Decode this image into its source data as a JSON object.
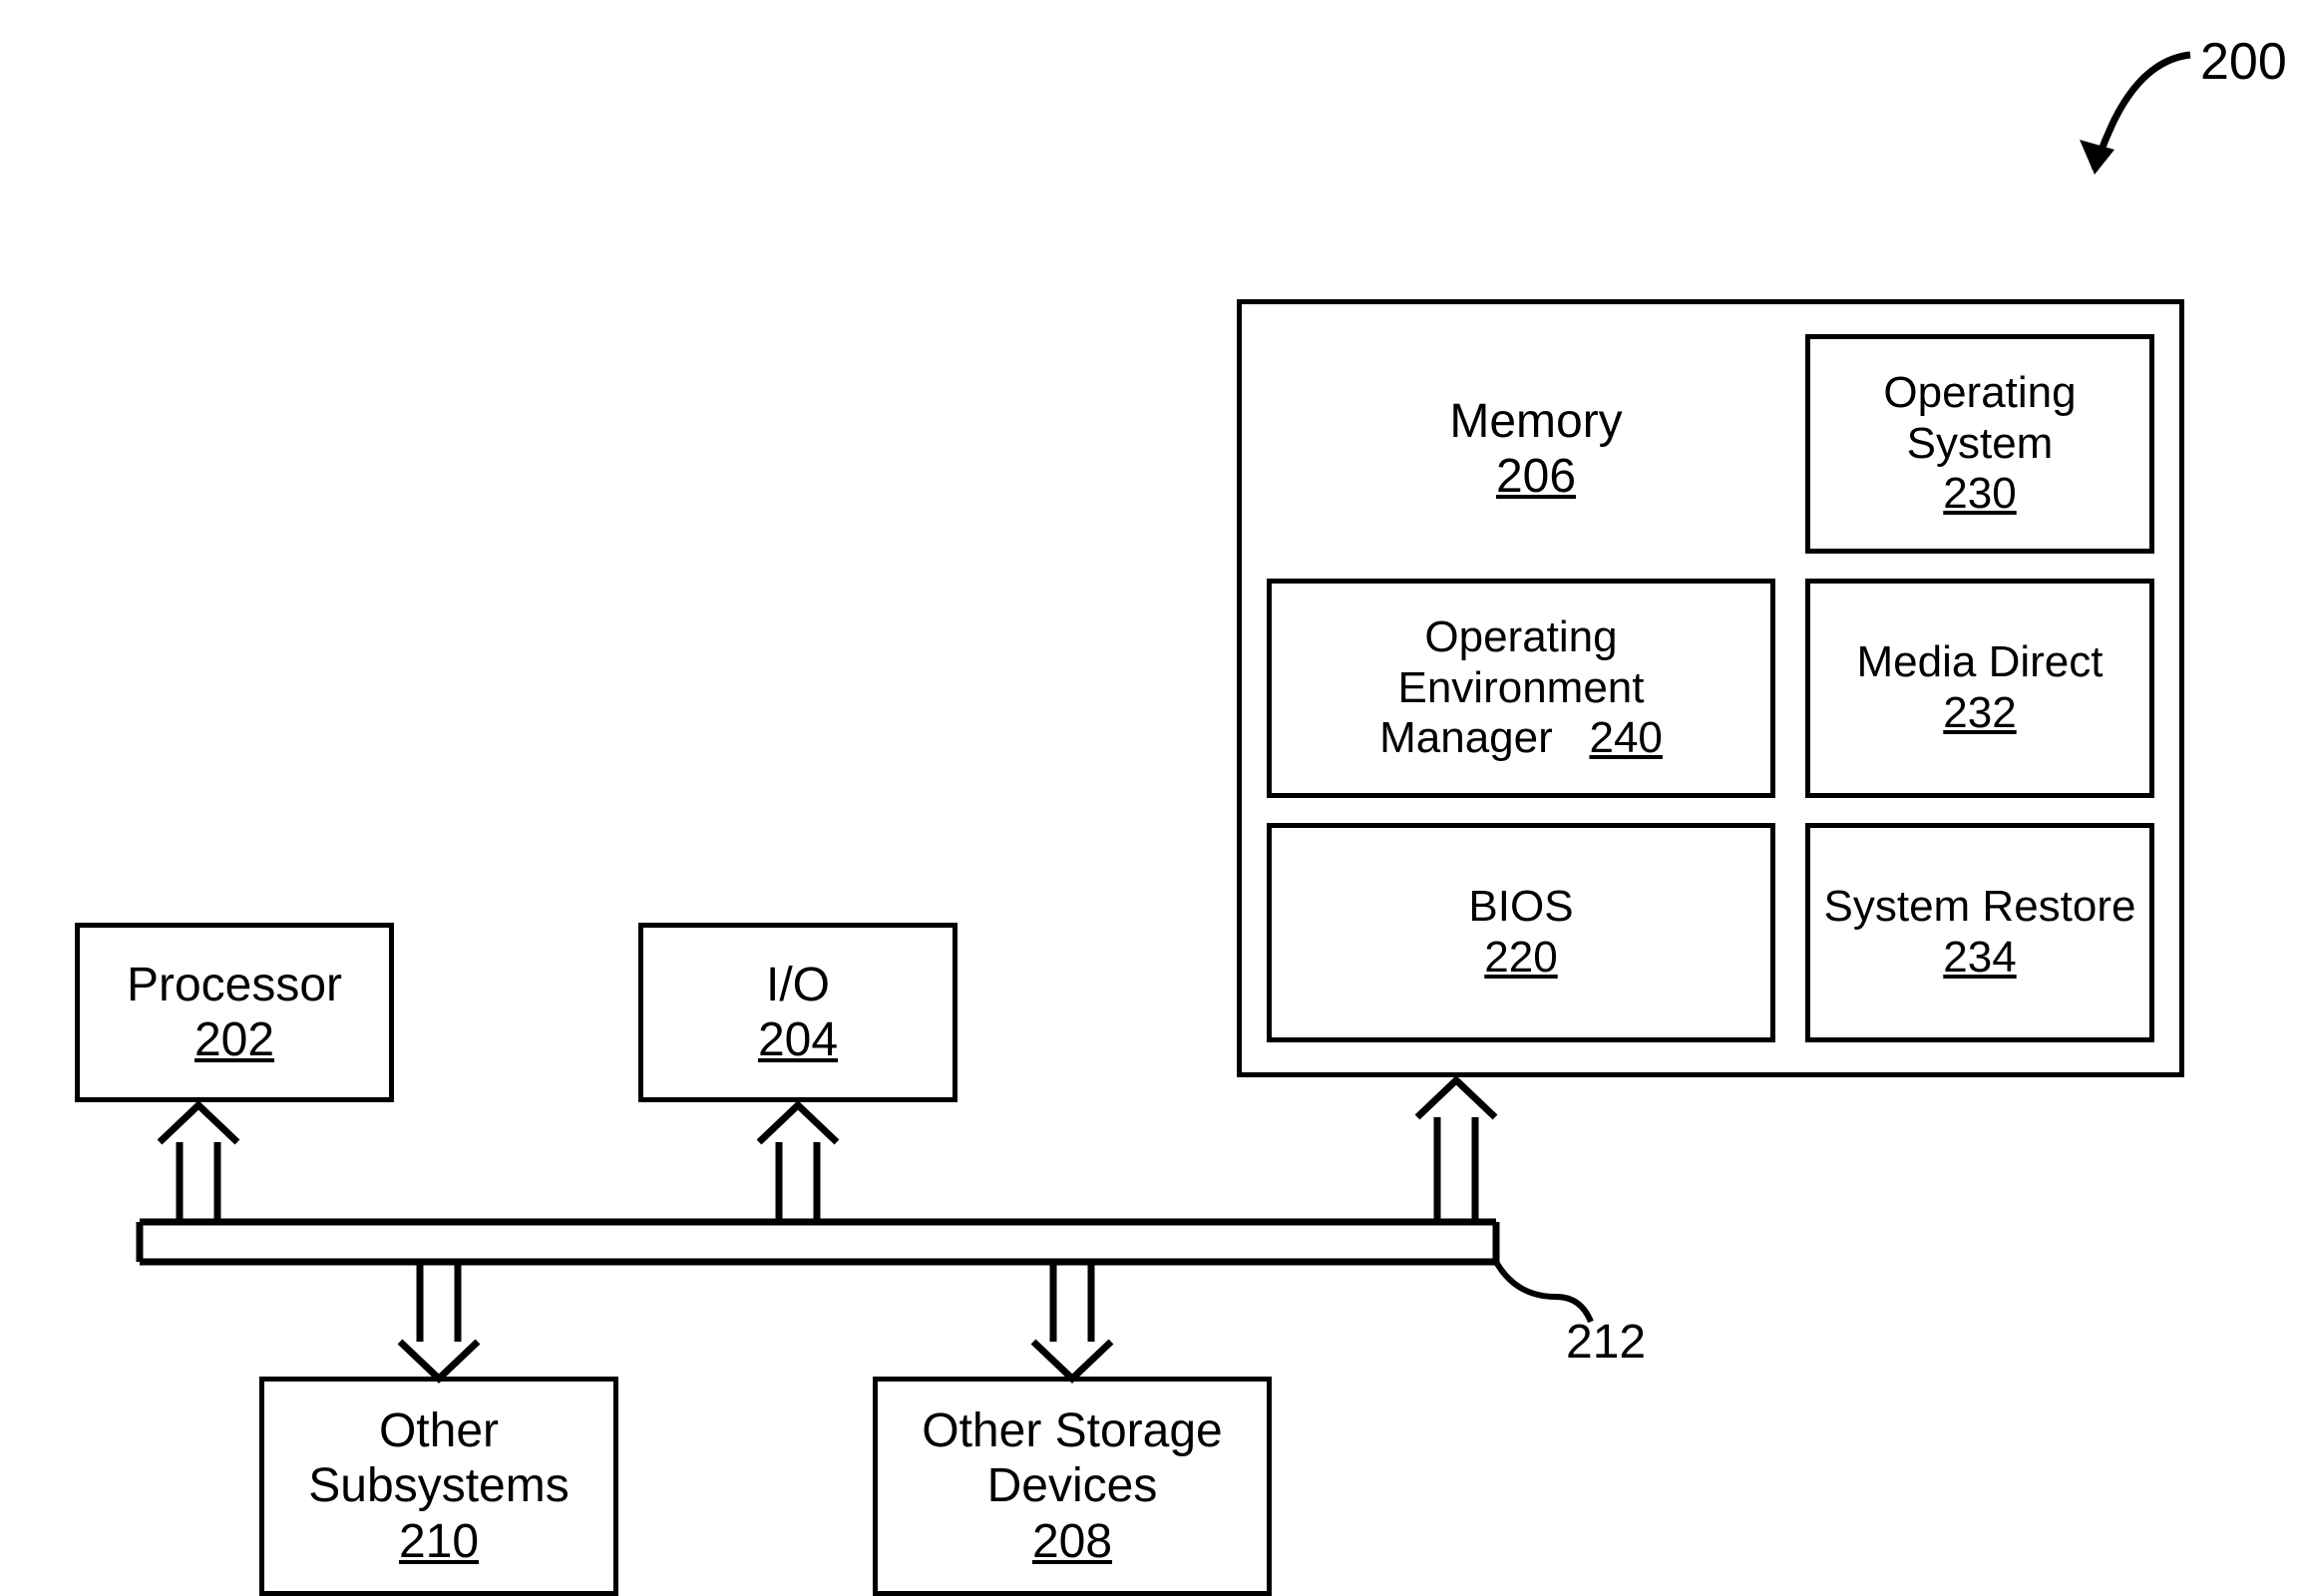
{
  "figure_ref": "200",
  "bus_ref": "212",
  "boxes": {
    "processor": {
      "label": "Processor",
      "ref": "202"
    },
    "io": {
      "label": "I/O",
      "ref": "204"
    },
    "subsystems": {
      "label1": "Other",
      "label2": "Subsystems",
      "ref": "210"
    },
    "storage": {
      "label1": "Other Storage",
      "label2": "Devices",
      "ref": "208"
    }
  },
  "memory": {
    "label": "Memory",
    "ref": "206",
    "oem": {
      "label1": "Operating",
      "label2": "Environment",
      "label3": "Manager",
      "ref": "240"
    },
    "bios": {
      "label": "BIOS",
      "ref": "220"
    },
    "os": {
      "label1": "Operating",
      "label2": "System",
      "ref": "230"
    },
    "md": {
      "label": "Media Direct",
      "ref": "232"
    },
    "sr": {
      "label": "System Restore",
      "ref": "234"
    }
  }
}
